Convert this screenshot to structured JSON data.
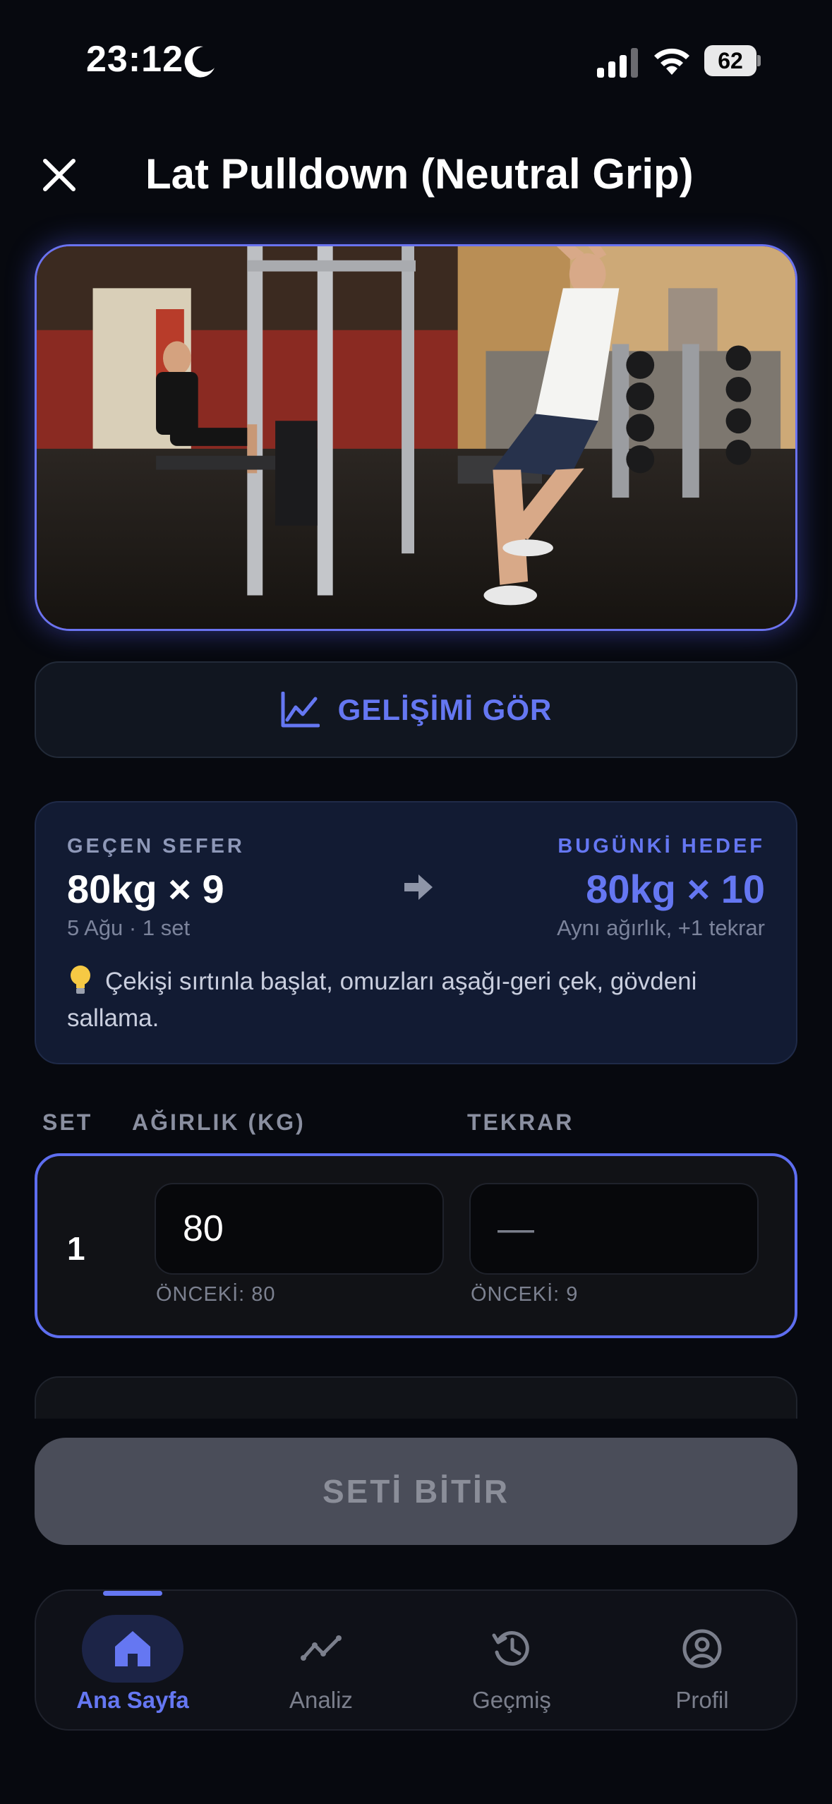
{
  "status_bar": {
    "time": "23:12",
    "battery": "62"
  },
  "header": {
    "title": "Lat Pulldown (Neutral Grip)"
  },
  "progress_button": {
    "label": "GELİŞİMİ GÖR"
  },
  "comparison": {
    "last_label": "GEÇEN SEFER",
    "last_value": "80kg × 9",
    "last_meta": "5 Ağu · 1 set",
    "target_label": "BUGÜNKİ HEDEF",
    "target_value": "80kg × 10",
    "target_meta": "Aynı ağırlık, +1 tekrar",
    "tip": "Çekişi sırtınla başlat, omuzları aşağı-geri çek, gövdeni sallama."
  },
  "table": {
    "col_set": "SET",
    "col_weight": "AĞIRLIK (KG)",
    "col_reps": "TEKRAR",
    "rows": [
      {
        "set": "1",
        "weight": "80",
        "reps": "—",
        "prev_weight": "ÖNCEKİ: 80",
        "prev_reps": "ÖNCEKİ: 9"
      }
    ]
  },
  "finish_button": {
    "label": "SETİ BİTİR"
  },
  "tabs": [
    {
      "label": "Ana Sayfa",
      "icon": "home-icon",
      "active": true
    },
    {
      "label": "Analiz",
      "icon": "analytics-icon",
      "active": false
    },
    {
      "label": "Geçmiş",
      "icon": "history-icon",
      "active": false
    },
    {
      "label": "Profil",
      "icon": "profile-icon",
      "active": false
    }
  ],
  "colors": {
    "accent": "#6577f2",
    "background": "#07090f",
    "card": "#121b33"
  }
}
